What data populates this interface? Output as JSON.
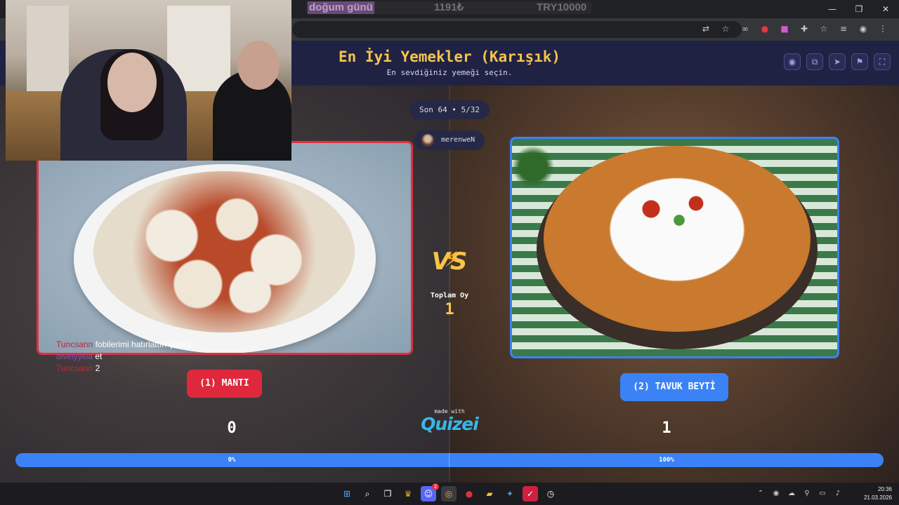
{
  "browser": {
    "ticker": {
      "item1": "doğum günü",
      "item2": "1191₺",
      "item3": "TRY10000"
    },
    "window_controls": {
      "minimize": "—",
      "restore": "❐",
      "close": "✕"
    }
  },
  "quiz": {
    "title": "En İyi Yemekler (Karışık)",
    "subtitle": "En sevdiğiniz yemeği seçin.",
    "round": "Son 64 • 5/32",
    "username": "merenweN",
    "vs_label": "VS",
    "total_label": "Toplam Oy",
    "total_votes": "1",
    "left": {
      "label": "(1) MANTI",
      "votes": "0",
      "percent_label": "0%",
      "percent": 0,
      "color": "#e0283c"
    },
    "right": {
      "label": "(2) TAVUK BEYTİ",
      "votes": "1",
      "percent_label": "100%",
      "percent": 100,
      "color": "#3b82f6"
    },
    "made_with": "made with",
    "brand": "Quizei"
  },
  "header_actions": [
    "eye-icon",
    "copy-icon",
    "send-icon",
    "flag-icon",
    "fullscreen-icon"
  ],
  "chat": [
    {
      "user": "Tuncsann",
      "message": "fobilerimi hatırlattın çünkü"
    },
    {
      "user": "divelyykia",
      "message": "et"
    },
    {
      "user": "Tuncsann",
      "message": "2"
    }
  ],
  "clock": {
    "time": "20:36",
    "date": "21.03.2026"
  },
  "taskbar_apps": [
    "windows-start-icon",
    "search-icon",
    "task-view-icon",
    "app-icon",
    "discord-icon",
    "chrome-icon",
    "app-red-icon",
    "file-explorer-icon",
    "app-blue-icon",
    "app-pink-icon",
    "app-clock-icon"
  ],
  "discord_badge": "2"
}
